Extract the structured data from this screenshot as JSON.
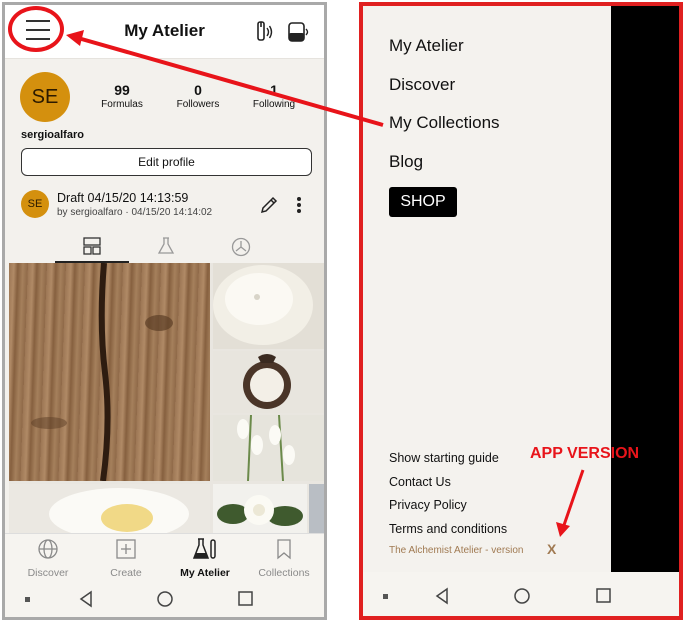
{
  "left_screen": {
    "header": {
      "title": "My Atelier"
    },
    "profile": {
      "avatar_initials": "SE",
      "stats": [
        {
          "value": "99",
          "label": "Formulas"
        },
        {
          "value": "0",
          "label": "Followers"
        },
        {
          "value": "1",
          "label": "Following"
        }
      ],
      "username": "sergioalfaro",
      "edit_label": "Edit profile"
    },
    "draft": {
      "avatar_initials": "SE",
      "title": "Draft 04/15/20 14:13:59",
      "byline": "by sergioalfaro · 04/15/20 14:14:02"
    },
    "bottom_nav": [
      {
        "label": "Discover"
      },
      {
        "label": "Create"
      },
      {
        "label": "My Atelier"
      },
      {
        "label": "Collections"
      }
    ]
  },
  "drawer": {
    "menu": [
      {
        "label": "My Atelier"
      },
      {
        "label": "Discover"
      },
      {
        "label": "My Collections"
      },
      {
        "label": "Blog"
      }
    ],
    "shop_label": "SHOP",
    "footer_links": [
      {
        "label": "Show starting guide"
      },
      {
        "label": "Contact Us"
      },
      {
        "label": "Privacy Policy"
      },
      {
        "label": "Terms and conditions"
      }
    ],
    "version_text": "The Alchemist Atelier - version",
    "version_value": "X"
  },
  "annotation": {
    "label": "APP VERSION",
    "color": "#e8141a"
  },
  "colors": {
    "avatar": "#d4900e",
    "drawer_bg": "#f4f2ee",
    "version_text": "#a07a52"
  }
}
